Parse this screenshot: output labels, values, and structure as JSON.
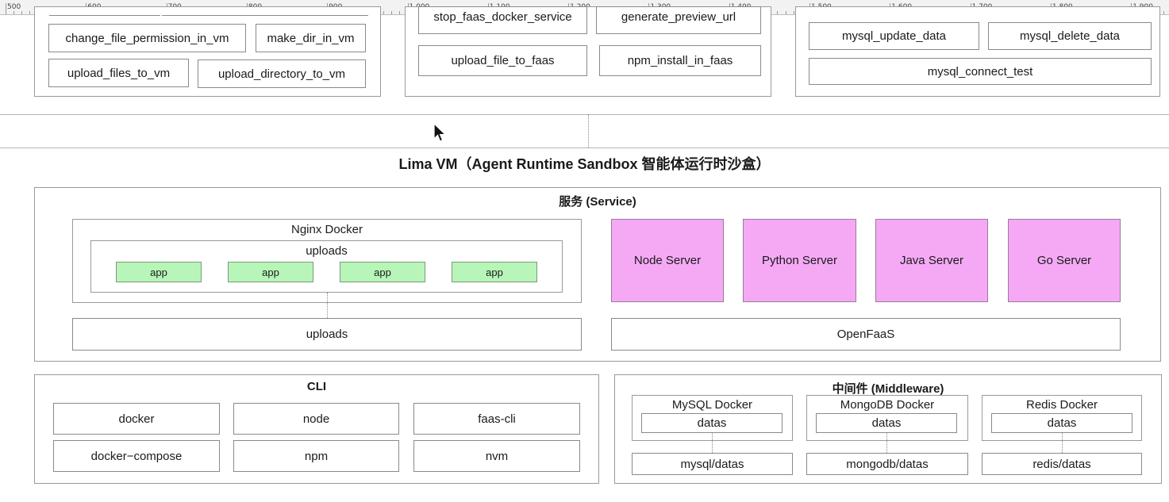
{
  "ruler": {
    "labels": [
      "500",
      "600",
      "700",
      "800",
      "900",
      "1,000",
      "1,100",
      "1,200",
      "1,300",
      "1,400",
      "1,500",
      "1,600",
      "1,700",
      "1,800",
      "1,900"
    ]
  },
  "top": {
    "vm_buttons": [
      "change_file_permission_in_vm",
      "make_dir_in_vm",
      "upload_files_to_vm",
      "upload_directory_to_vm"
    ],
    "faas_buttons": [
      "stop_faas_docker_service",
      "generate_preview_url",
      "upload_file_to_faas",
      "npm_install_in_faas"
    ],
    "mysql_buttons": [
      "mysql_update_data",
      "mysql_delete_data",
      "mysql_connect_test"
    ]
  },
  "title": "Lima VM（Agent Runtime Sandbox 智能体运行时沙盒）",
  "service": {
    "title": "服务 (Service)",
    "nginx_title": "Nginx Docker",
    "uploads_inner": "uploads",
    "apps": [
      "app",
      "app",
      "app",
      "app"
    ],
    "servers": [
      "Node Server",
      "Python Server",
      "Java Server",
      "Go Server"
    ],
    "uploads_volume": "uploads",
    "openfaas": "OpenFaaS"
  },
  "cli": {
    "title": "CLI",
    "tools": [
      "docker",
      "node",
      "faas-cli",
      "docker−compose",
      "npm",
      "nvm"
    ]
  },
  "middleware": {
    "title": "中间件 (Middleware)",
    "dockers": [
      {
        "name": "MySQL Docker",
        "inner": "datas",
        "volume": "mysql/datas"
      },
      {
        "name": "MongoDB Docker",
        "inner": "datas",
        "volume": "mongodb/datas"
      },
      {
        "name": "Redis Docker",
        "inner": "datas",
        "volume": "redis/datas"
      }
    ]
  }
}
